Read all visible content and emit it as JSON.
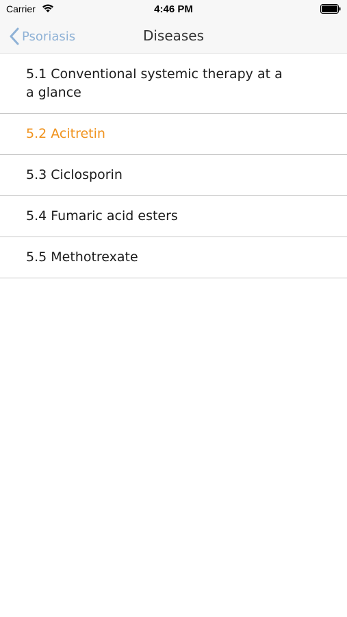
{
  "status_bar": {
    "carrier": "Carrier",
    "time": "4:46 PM",
    "icons": [
      "wifi-icon",
      "battery-icon"
    ]
  },
  "nav": {
    "back_label": "Psoriasis",
    "title": "Diseases",
    "back_color": "#8fb2d6"
  },
  "list": {
    "items": [
      {
        "label": "5.1 Conventional systemic therapy at a a glance",
        "selected": false
      },
      {
        "label": "5.2 Acitretin",
        "selected": true
      },
      {
        "label": "5.3 Ciclosporin",
        "selected": false
      },
      {
        "label": "5.4 Fumaric acid esters",
        "selected": false
      },
      {
        "label": "5.5 Methotrexate",
        "selected": false
      }
    ],
    "selected_color": "#f0921c"
  }
}
